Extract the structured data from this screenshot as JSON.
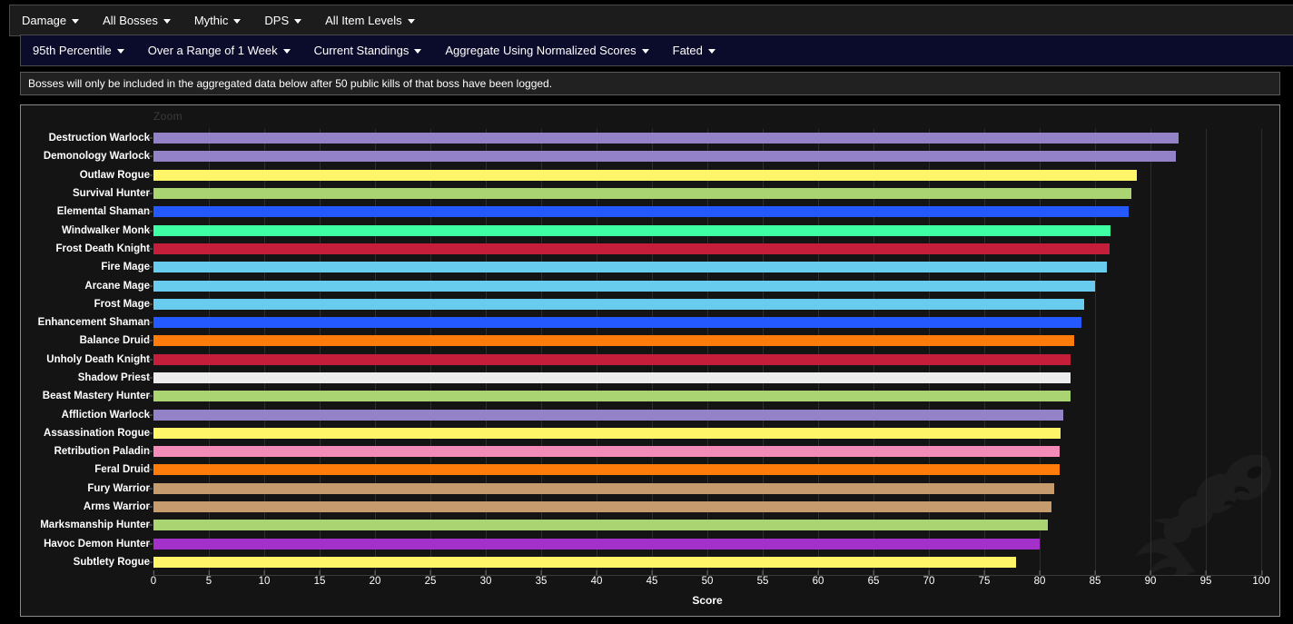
{
  "toolbar_primary": {
    "items": [
      {
        "label": "Damage",
        "name": "filter-metric"
      },
      {
        "label": "All Bosses",
        "name": "filter-boss"
      },
      {
        "label": "Mythic",
        "name": "filter-difficulty"
      },
      {
        "label": "DPS",
        "name": "filter-role"
      },
      {
        "label": "All Item Levels",
        "name": "filter-item-level"
      }
    ]
  },
  "toolbar_secondary": {
    "items": [
      {
        "label": "95th Percentile",
        "name": "filter-percentile"
      },
      {
        "label": "Over a Range of 1 Week",
        "name": "filter-time-range"
      },
      {
        "label": "Current Standings",
        "name": "filter-standings"
      },
      {
        "label": "Aggregate Using Normalized Scores",
        "name": "filter-aggregation"
      },
      {
        "label": "Fated",
        "name": "filter-fated"
      }
    ]
  },
  "notice": {
    "text": "Bosses will only be included in the aggregated data below after 50 public kills of that boss have been logged."
  },
  "chart": {
    "zoom_label": "Zoom"
  },
  "chart_data": {
    "type": "bar",
    "orientation": "horizontal",
    "title": "",
    "xlabel": "Score",
    "ylabel": "",
    "xlim": [
      0,
      100
    ],
    "xticks": [
      0,
      5,
      10,
      15,
      20,
      25,
      30,
      35,
      40,
      45,
      50,
      55,
      60,
      65,
      70,
      75,
      80,
      85,
      90,
      95,
      100
    ],
    "grid": true,
    "grid_axis": "x",
    "legend": "none",
    "categories": [
      "Destruction Warlock",
      "Demonology Warlock",
      "Outlaw Rogue",
      "Survival Hunter",
      "Elemental Shaman",
      "Windwalker Monk",
      "Frost Death Knight",
      "Fire Mage",
      "Arcane Mage",
      "Frost Mage",
      "Enhancement Shaman",
      "Balance Druid",
      "Unholy Death Knight",
      "Shadow Priest",
      "Beast Mastery Hunter",
      "Affliction Warlock",
      "Assassination Rogue",
      "Retribution Paladin",
      "Feral Druid",
      "Fury Warrior",
      "Arms Warrior",
      "Marksmanship Hunter",
      "Havoc Demon Hunter",
      "Subtlety Rogue"
    ],
    "values": [
      92.5,
      92.3,
      88.8,
      88.3,
      88.0,
      86.4,
      86.3,
      86.1,
      85.0,
      84.0,
      83.8,
      83.1,
      82.8,
      82.8,
      82.8,
      82.1,
      81.9,
      81.8,
      81.8,
      81.3,
      81.1,
      80.7,
      80.0,
      77.9
    ],
    "colors": [
      "#9482C9",
      "#9482C9",
      "#FFF569",
      "#AAD372",
      "#2359FF",
      "#3FFFA5",
      "#C41E3A",
      "#68CCEF",
      "#68CCEF",
      "#68CCEF",
      "#2359FF",
      "#FF7C0A",
      "#C41E3A",
      "#ECECEC",
      "#AAD372",
      "#9482C9",
      "#FFF569",
      "#F48CBA",
      "#FF7C0A",
      "#C69B6D",
      "#C69B6D",
      "#AAD372",
      "#A330C9",
      "#FFF569"
    ]
  }
}
